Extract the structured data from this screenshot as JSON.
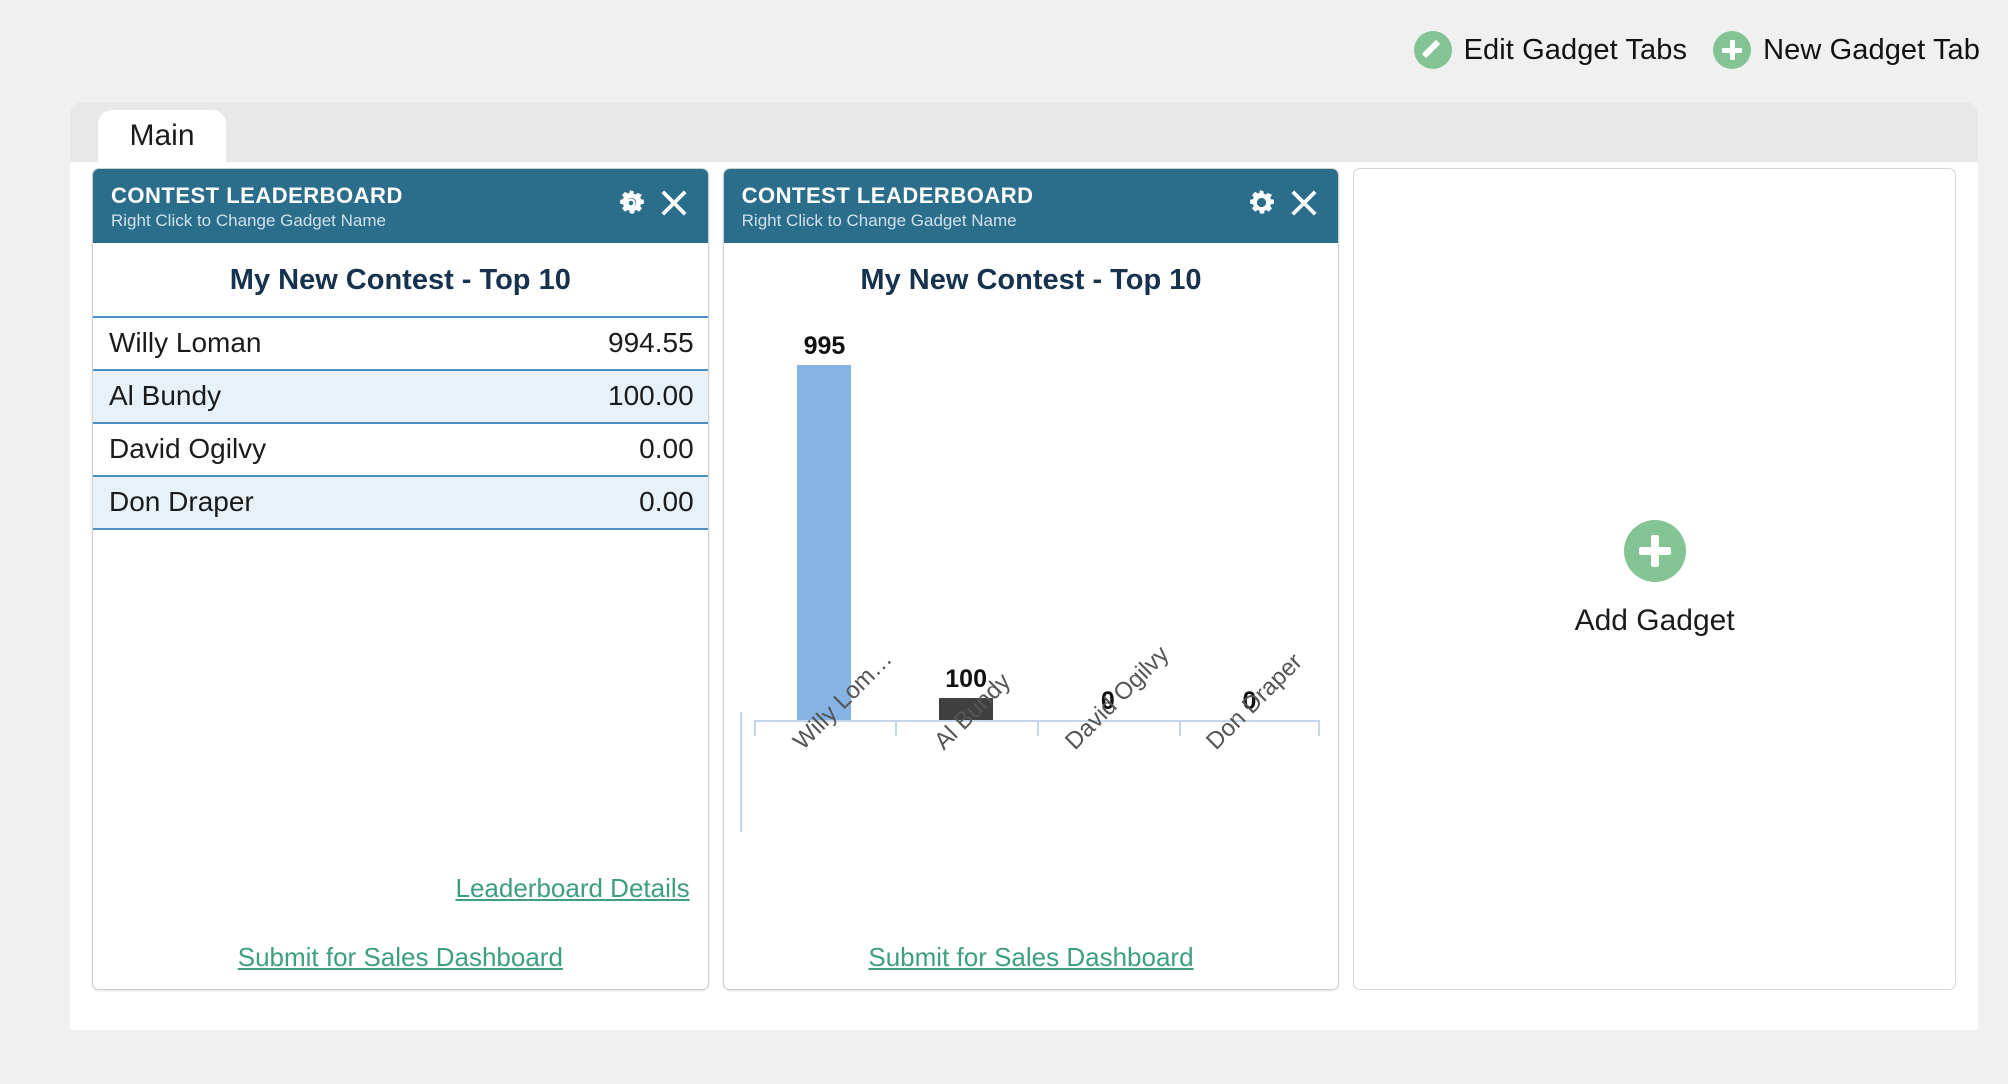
{
  "toolbar": {
    "edit_tabs_label": "Edit Gadget Tabs",
    "new_tab_label": "New Gadget Tab",
    "edit_icon": "pencil-circle-icon",
    "new_icon": "plus-circle-icon",
    "accent_green": "#82c493"
  },
  "tabs": [
    {
      "label": "Main",
      "active": true
    }
  ],
  "colors": {
    "gadget_header": "#2b6e8c",
    "link": "#3d9e82",
    "row_divider": "#4a90c4",
    "row_alt_bg": "#e8f0f8",
    "page_bg": "#f0f0f0",
    "tabbar_bg": "#e8e8e8",
    "bar_primary": "#85b3e4",
    "bar_secondary": "#404040",
    "axis": "#c5d5ea"
  },
  "gadgets": [
    {
      "header_title": "CONTEST LEADERBOARD",
      "header_subtitle": "Right Click to Change Gadget Name",
      "settings_icon": "gear-icon",
      "close_icon": "close-x-icon",
      "contest_title": "My New Contest - Top 10",
      "rows": [
        {
          "name": "Willy Loman",
          "value": "994.55"
        },
        {
          "name": "Al Bundy",
          "value": "100.00"
        },
        {
          "name": "David Ogilvy",
          "value": "0.00"
        },
        {
          "name": "Don Draper",
          "value": "0.00"
        }
      ],
      "details_link": "Leaderboard Details",
      "submit_link": "Submit for Sales Dashboard"
    },
    {
      "header_title": "CONTEST LEADERBOARD",
      "header_subtitle": "Right Click to Change Gadget Name",
      "settings_icon": "gear-icon",
      "close_icon": "close-x-icon",
      "contest_title": "My New Contest - Top 10",
      "submit_link": "Submit for Sales Dashboard"
    }
  ],
  "add_gadget": {
    "label": "Add Gadget",
    "icon": "plus-circle-icon"
  },
  "chart_data": {
    "type": "bar",
    "title": "My New Contest - Top 10",
    "categories": [
      "Willy Loman",
      "Al Bundy",
      "David Ogilvy",
      "Don Draper"
    ],
    "tick_labels": [
      "Willy Lom…",
      "Al Bundy",
      "David Ogilvy",
      "Don Draper"
    ],
    "values": [
      995,
      100,
      0,
      0
    ],
    "data_labels": [
      "995",
      "100",
      "0",
      "0"
    ],
    "bar_colors": [
      "#85b3e4",
      "#404040",
      "#404040",
      "#404040"
    ],
    "xlabel": "",
    "ylabel": "",
    "ylim": [
      0,
      1100
    ],
    "grid": false,
    "legend": false,
    "xtick_rotation": -45
  }
}
